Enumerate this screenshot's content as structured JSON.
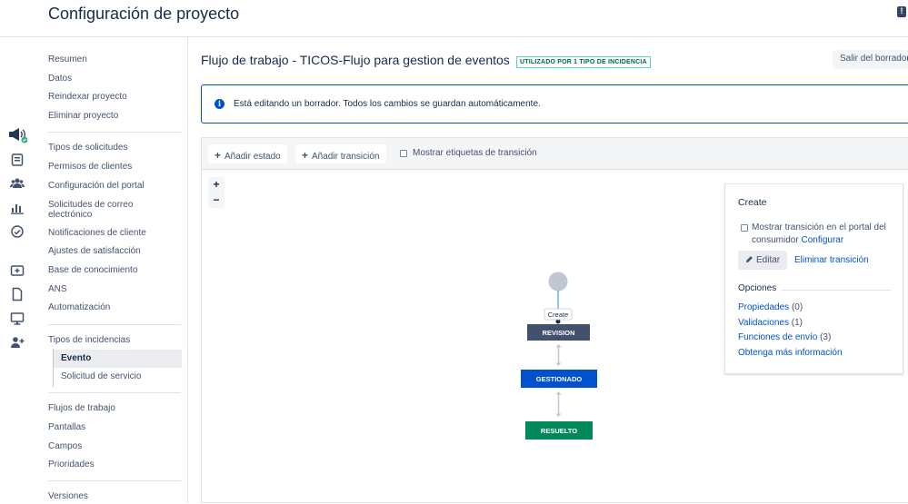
{
  "header": {
    "title": "Configuración de proyecto",
    "feedback_icon": "feedback-icon"
  },
  "icon_rail": [
    "megaphone-icon",
    "queue-icon",
    "customers-icon",
    "reports-icon",
    "sla-icon",
    "add-issue-icon",
    "page-icon",
    "monitor-icon",
    "add-person-icon"
  ],
  "sidebar": {
    "group1": [
      "Resumen",
      "Datos",
      "Reindexar proyecto",
      "Eliminar proyecto"
    ],
    "group2": [
      "Tipos de solicitudes",
      "Permisos de clientes",
      "Configuración del portal",
      "Solicitudes de correo electrónico",
      "Notificaciones de cliente",
      "Ajustes de satisfacción",
      "Base de conocimiento",
      "ANS",
      "Automatización"
    ],
    "group3_title": "Tipos de incidencias",
    "group3_children": [
      "Evento",
      "Solicitud de servicio"
    ],
    "group4": [
      "Flujos de trabajo",
      "Pantallas",
      "Campos",
      "Prioridades"
    ],
    "group5": [
      "Versiones"
    ]
  },
  "main": {
    "workflow_title": "Flujo de trabajo - TICOS-Flujo para gestion de eventos",
    "used_badge": "UTILIZADO POR 1 TIPO DE INCIDENCIA",
    "exit_button": "Salir del borrador",
    "info_text": "Está editando un borrador. Todos los cambios se guardan automáticamente."
  },
  "toolbar": {
    "add_status": "Añadir estado",
    "add_transition": "Añadir transición",
    "show_labels": "Mostrar etiquetas de transición"
  },
  "zoom": {
    "in": "+",
    "out": "−"
  },
  "diagram": {
    "transition_label": "Create",
    "statuses": [
      {
        "name": "REVISION",
        "color": "#42526e"
      },
      {
        "name": "GESTIONADO",
        "color": "#0052cc"
      },
      {
        "name": "RESUELTO",
        "color": "#00875a"
      }
    ]
  },
  "panel": {
    "title": "Create",
    "check_text": "Mostrar transición en el portal del consumidor",
    "check_link": "Configurar",
    "edit_button": "Editar",
    "delete_link": "Eliminar transición",
    "options_title": "Opciones",
    "options": [
      {
        "link": "Propiedades",
        "count": "(0)"
      },
      {
        "link": "Validaciones",
        "count": "(1)"
      },
      {
        "link": "Funciones de envío",
        "count": "(3)"
      },
      {
        "link": "Obtenga más información",
        "count": ""
      }
    ]
  }
}
